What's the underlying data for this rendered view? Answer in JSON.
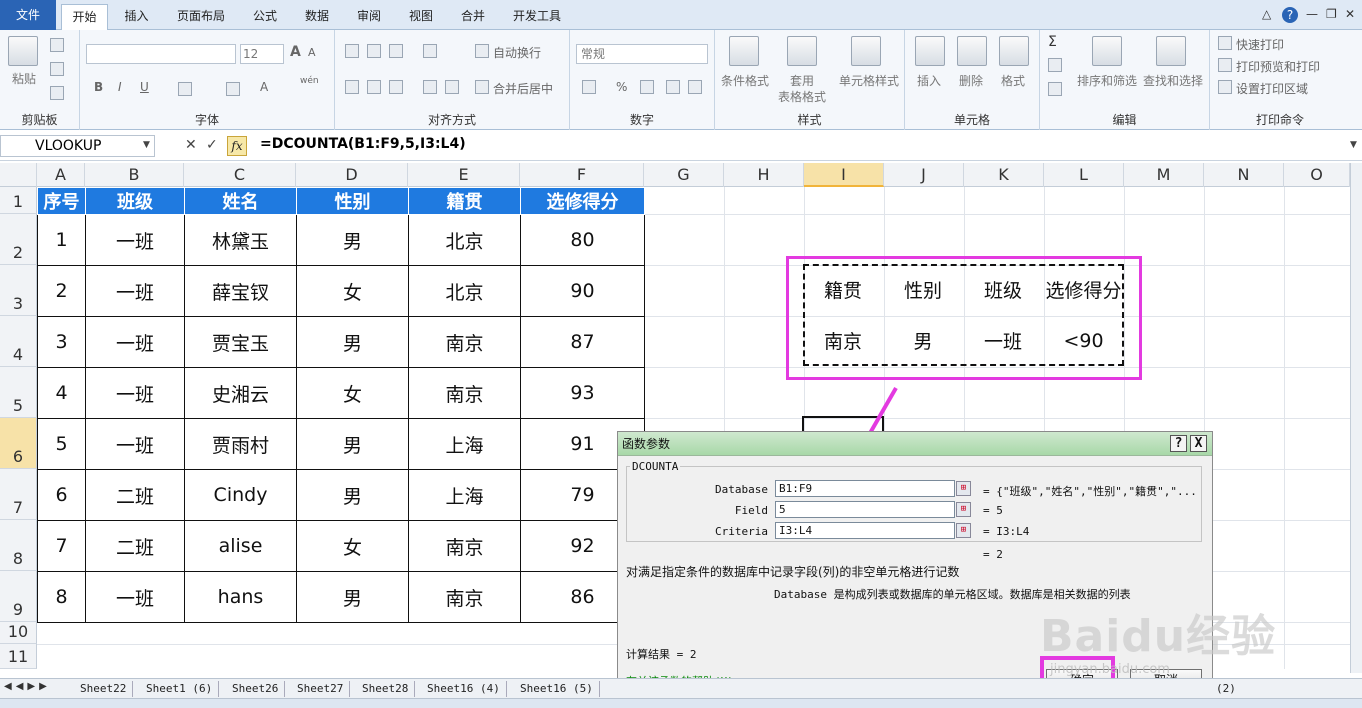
{
  "ribbon_tabs": [
    "文件",
    "开始",
    "插入",
    "页面布局",
    "公式",
    "数据",
    "审阅",
    "视图",
    "合并",
    "开发工具"
  ],
  "ribbon": {
    "clipboard": {
      "label": "剪贴板",
      "paste": "粘贴"
    },
    "font": {
      "label": "字体",
      "size": "12",
      "bold": "B",
      "italic": "I",
      "underline": "U",
      "grow": "A",
      "shrink": "A",
      "wen": "wén"
    },
    "alignment": {
      "label": "对齐方式",
      "wrap": "自动换行",
      "merge": "合并后居中"
    },
    "number": {
      "label": "数字",
      "format": "常规",
      "percent": "%"
    },
    "styles": {
      "label": "样式",
      "cond": "条件格式",
      "table1": "套用",
      "table2": "表格格式",
      "cell": "单元格样式"
    },
    "cells": {
      "label": "单元格",
      "insert": "插入",
      "delete": "删除",
      "format": "格式"
    },
    "editing": {
      "label": "编辑",
      "sigma": "Σ",
      "sort": "排序和筛选",
      "find": "查找和选择"
    },
    "print": {
      "label": "打印命令",
      "quick": "快速打印",
      "preview": "打印预览和打印",
      "area": "设置打印区域"
    }
  },
  "namebox": "VLOOKUP",
  "fx_label": "fx",
  "formula": "=DCOUNTA(B1:F9,5,I3:L4)",
  "columns": [
    "A",
    "B",
    "C",
    "D",
    "E",
    "F",
    "G",
    "H",
    "I",
    "J",
    "K",
    "L",
    "M",
    "N",
    "O"
  ],
  "rows": [
    "1",
    "2",
    "3",
    "4",
    "5",
    "6",
    "7",
    "8",
    "9",
    "10",
    "11"
  ],
  "table": {
    "headers": [
      "序号",
      "班级",
      "姓名",
      "性别",
      "籍贯",
      "选修得分"
    ],
    "rows": [
      [
        "1",
        "一班",
        "林黛玉",
        "男",
        "北京",
        "80"
      ],
      [
        "2",
        "一班",
        "薛宝钗",
        "女",
        "北京",
        "90"
      ],
      [
        "3",
        "一班",
        "贾宝玉",
        "男",
        "南京",
        "87"
      ],
      [
        "4",
        "一班",
        "史湘云",
        "女",
        "南京",
        "93"
      ],
      [
        "5",
        "一班",
        "贾雨村",
        "男",
        "上海",
        "91"
      ],
      [
        "6",
        "二班",
        "Cindy",
        "男",
        "上海",
        "79"
      ],
      [
        "7",
        "二班",
        "alise",
        "女",
        "南京",
        "92"
      ],
      [
        "8",
        "一班",
        "hans",
        "男",
        "南京",
        "86"
      ]
    ]
  },
  "criteria": {
    "headers": [
      "籍贯",
      "性别",
      "班级",
      "选修得分"
    ],
    "values": [
      "南京",
      "男",
      "一班",
      "<90"
    ]
  },
  "dialog": {
    "title": "函数参数",
    "help_btn": "?",
    "close_btn": "X",
    "func": "DCOUNTA",
    "collapse_glyph": "⊞",
    "args": [
      {
        "label": "Database",
        "value": "B1:F9",
        "result": "= {\"班级\",\"姓名\",\"性别\",\"籍贯\",\"..."
      },
      {
        "label": "Field",
        "value": "5",
        "result": "= 5"
      },
      {
        "label": "Criteria",
        "value": "I3:L4",
        "result": "= I3:L4"
      }
    ],
    "total_eq": "= 2",
    "description": "对满足指定条件的数据库中记录字段(列)的非空单元格进行记数",
    "arg_help": "Database  是构成列表或数据库的单元格区域。数据库是相关数据的列表",
    "calc_result": "计算结果 =  2",
    "help_link": "有关该函数的帮助(H)",
    "ok": "确定",
    "cancel": "取消"
  },
  "sheets": [
    "Sheet22",
    "Sheet1 (6)",
    "Sheet26",
    "Sheet27",
    "Sheet28",
    "Sheet16 (4)",
    "Sheet16 (5)"
  ],
  "sheet_extra": "(2)",
  "watermark": "Baidu经验",
  "watermark_url": "jingyan.baidu.com",
  "colors": {
    "header_blue": "#1f7ae0",
    "annotation_magenta": "#e33ae0",
    "dialog_green": "#a8d8a8"
  }
}
